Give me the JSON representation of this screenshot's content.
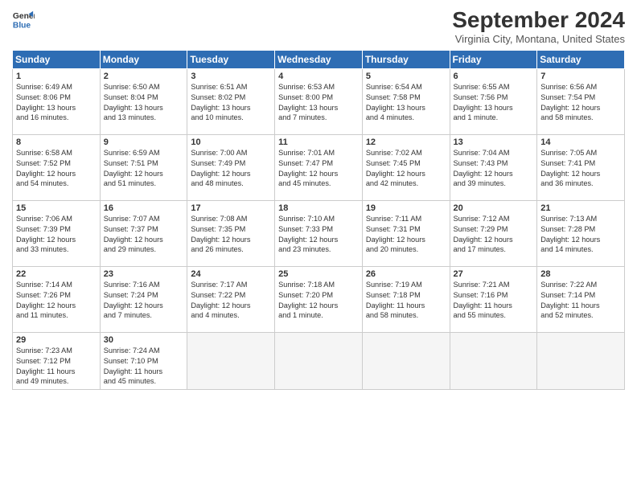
{
  "header": {
    "logo_line1": "General",
    "logo_line2": "Blue",
    "month_title": "September 2024",
    "location": "Virginia City, Montana, United States"
  },
  "weekdays": [
    "Sunday",
    "Monday",
    "Tuesday",
    "Wednesday",
    "Thursday",
    "Friday",
    "Saturday"
  ],
  "weeks": [
    [
      {
        "day": "1",
        "info": "Sunrise: 6:49 AM\nSunset: 8:06 PM\nDaylight: 13 hours\nand 16 minutes."
      },
      {
        "day": "2",
        "info": "Sunrise: 6:50 AM\nSunset: 8:04 PM\nDaylight: 13 hours\nand 13 minutes."
      },
      {
        "day": "3",
        "info": "Sunrise: 6:51 AM\nSunset: 8:02 PM\nDaylight: 13 hours\nand 10 minutes."
      },
      {
        "day": "4",
        "info": "Sunrise: 6:53 AM\nSunset: 8:00 PM\nDaylight: 13 hours\nand 7 minutes."
      },
      {
        "day": "5",
        "info": "Sunrise: 6:54 AM\nSunset: 7:58 PM\nDaylight: 13 hours\nand 4 minutes."
      },
      {
        "day": "6",
        "info": "Sunrise: 6:55 AM\nSunset: 7:56 PM\nDaylight: 13 hours\nand 1 minute."
      },
      {
        "day": "7",
        "info": "Sunrise: 6:56 AM\nSunset: 7:54 PM\nDaylight: 12 hours\nand 58 minutes."
      }
    ],
    [
      {
        "day": "8",
        "info": "Sunrise: 6:58 AM\nSunset: 7:52 PM\nDaylight: 12 hours\nand 54 minutes."
      },
      {
        "day": "9",
        "info": "Sunrise: 6:59 AM\nSunset: 7:51 PM\nDaylight: 12 hours\nand 51 minutes."
      },
      {
        "day": "10",
        "info": "Sunrise: 7:00 AM\nSunset: 7:49 PM\nDaylight: 12 hours\nand 48 minutes."
      },
      {
        "day": "11",
        "info": "Sunrise: 7:01 AM\nSunset: 7:47 PM\nDaylight: 12 hours\nand 45 minutes."
      },
      {
        "day": "12",
        "info": "Sunrise: 7:02 AM\nSunset: 7:45 PM\nDaylight: 12 hours\nand 42 minutes."
      },
      {
        "day": "13",
        "info": "Sunrise: 7:04 AM\nSunset: 7:43 PM\nDaylight: 12 hours\nand 39 minutes."
      },
      {
        "day": "14",
        "info": "Sunrise: 7:05 AM\nSunset: 7:41 PM\nDaylight: 12 hours\nand 36 minutes."
      }
    ],
    [
      {
        "day": "15",
        "info": "Sunrise: 7:06 AM\nSunset: 7:39 PM\nDaylight: 12 hours\nand 33 minutes."
      },
      {
        "day": "16",
        "info": "Sunrise: 7:07 AM\nSunset: 7:37 PM\nDaylight: 12 hours\nand 29 minutes."
      },
      {
        "day": "17",
        "info": "Sunrise: 7:08 AM\nSunset: 7:35 PM\nDaylight: 12 hours\nand 26 minutes."
      },
      {
        "day": "18",
        "info": "Sunrise: 7:10 AM\nSunset: 7:33 PM\nDaylight: 12 hours\nand 23 minutes."
      },
      {
        "day": "19",
        "info": "Sunrise: 7:11 AM\nSunset: 7:31 PM\nDaylight: 12 hours\nand 20 minutes."
      },
      {
        "day": "20",
        "info": "Sunrise: 7:12 AM\nSunset: 7:29 PM\nDaylight: 12 hours\nand 17 minutes."
      },
      {
        "day": "21",
        "info": "Sunrise: 7:13 AM\nSunset: 7:28 PM\nDaylight: 12 hours\nand 14 minutes."
      }
    ],
    [
      {
        "day": "22",
        "info": "Sunrise: 7:14 AM\nSunset: 7:26 PM\nDaylight: 12 hours\nand 11 minutes."
      },
      {
        "day": "23",
        "info": "Sunrise: 7:16 AM\nSunset: 7:24 PM\nDaylight: 12 hours\nand 7 minutes."
      },
      {
        "day": "24",
        "info": "Sunrise: 7:17 AM\nSunset: 7:22 PM\nDaylight: 12 hours\nand 4 minutes."
      },
      {
        "day": "25",
        "info": "Sunrise: 7:18 AM\nSunset: 7:20 PM\nDaylight: 12 hours\nand 1 minute."
      },
      {
        "day": "26",
        "info": "Sunrise: 7:19 AM\nSunset: 7:18 PM\nDaylight: 11 hours\nand 58 minutes."
      },
      {
        "day": "27",
        "info": "Sunrise: 7:21 AM\nSunset: 7:16 PM\nDaylight: 11 hours\nand 55 minutes."
      },
      {
        "day": "28",
        "info": "Sunrise: 7:22 AM\nSunset: 7:14 PM\nDaylight: 11 hours\nand 52 minutes."
      }
    ],
    [
      {
        "day": "29",
        "info": "Sunrise: 7:23 AM\nSunset: 7:12 PM\nDaylight: 11 hours\nand 49 minutes."
      },
      {
        "day": "30",
        "info": "Sunrise: 7:24 AM\nSunset: 7:10 PM\nDaylight: 11 hours\nand 45 minutes."
      },
      {
        "day": "",
        "info": ""
      },
      {
        "day": "",
        "info": ""
      },
      {
        "day": "",
        "info": ""
      },
      {
        "day": "",
        "info": ""
      },
      {
        "day": "",
        "info": ""
      }
    ]
  ]
}
